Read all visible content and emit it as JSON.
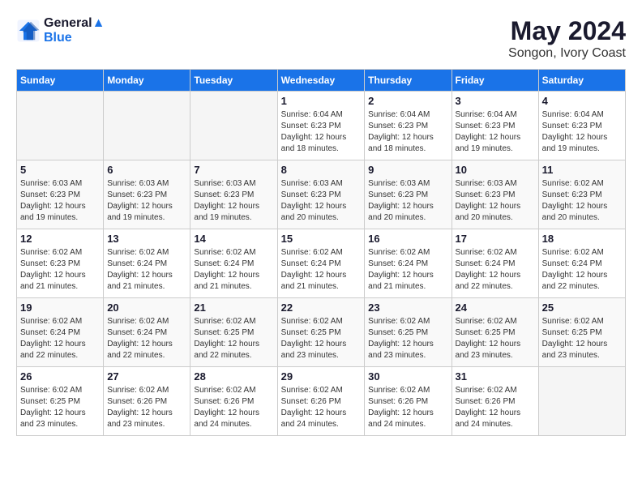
{
  "header": {
    "logo_line1": "General",
    "logo_line2": "Blue",
    "month": "May 2024",
    "location": "Songon, Ivory Coast"
  },
  "weekdays": [
    "Sunday",
    "Monday",
    "Tuesday",
    "Wednesday",
    "Thursday",
    "Friday",
    "Saturday"
  ],
  "weeks": [
    [
      {
        "day": "",
        "info": ""
      },
      {
        "day": "",
        "info": ""
      },
      {
        "day": "",
        "info": ""
      },
      {
        "day": "1",
        "info": "Sunrise: 6:04 AM\nSunset: 6:23 PM\nDaylight: 12 hours and 18 minutes."
      },
      {
        "day": "2",
        "info": "Sunrise: 6:04 AM\nSunset: 6:23 PM\nDaylight: 12 hours and 18 minutes."
      },
      {
        "day": "3",
        "info": "Sunrise: 6:04 AM\nSunset: 6:23 PM\nDaylight: 12 hours and 19 minutes."
      },
      {
        "day": "4",
        "info": "Sunrise: 6:04 AM\nSunset: 6:23 PM\nDaylight: 12 hours and 19 minutes."
      }
    ],
    [
      {
        "day": "5",
        "info": "Sunrise: 6:03 AM\nSunset: 6:23 PM\nDaylight: 12 hours and 19 minutes."
      },
      {
        "day": "6",
        "info": "Sunrise: 6:03 AM\nSunset: 6:23 PM\nDaylight: 12 hours and 19 minutes."
      },
      {
        "day": "7",
        "info": "Sunrise: 6:03 AM\nSunset: 6:23 PM\nDaylight: 12 hours and 19 minutes."
      },
      {
        "day": "8",
        "info": "Sunrise: 6:03 AM\nSunset: 6:23 PM\nDaylight: 12 hours and 20 minutes."
      },
      {
        "day": "9",
        "info": "Sunrise: 6:03 AM\nSunset: 6:23 PM\nDaylight: 12 hours and 20 minutes."
      },
      {
        "day": "10",
        "info": "Sunrise: 6:03 AM\nSunset: 6:23 PM\nDaylight: 12 hours and 20 minutes."
      },
      {
        "day": "11",
        "info": "Sunrise: 6:02 AM\nSunset: 6:23 PM\nDaylight: 12 hours and 20 minutes."
      }
    ],
    [
      {
        "day": "12",
        "info": "Sunrise: 6:02 AM\nSunset: 6:23 PM\nDaylight: 12 hours and 21 minutes."
      },
      {
        "day": "13",
        "info": "Sunrise: 6:02 AM\nSunset: 6:24 PM\nDaylight: 12 hours and 21 minutes."
      },
      {
        "day": "14",
        "info": "Sunrise: 6:02 AM\nSunset: 6:24 PM\nDaylight: 12 hours and 21 minutes."
      },
      {
        "day": "15",
        "info": "Sunrise: 6:02 AM\nSunset: 6:24 PM\nDaylight: 12 hours and 21 minutes."
      },
      {
        "day": "16",
        "info": "Sunrise: 6:02 AM\nSunset: 6:24 PM\nDaylight: 12 hours and 21 minutes."
      },
      {
        "day": "17",
        "info": "Sunrise: 6:02 AM\nSunset: 6:24 PM\nDaylight: 12 hours and 22 minutes."
      },
      {
        "day": "18",
        "info": "Sunrise: 6:02 AM\nSunset: 6:24 PM\nDaylight: 12 hours and 22 minutes."
      }
    ],
    [
      {
        "day": "19",
        "info": "Sunrise: 6:02 AM\nSunset: 6:24 PM\nDaylight: 12 hours and 22 minutes."
      },
      {
        "day": "20",
        "info": "Sunrise: 6:02 AM\nSunset: 6:24 PM\nDaylight: 12 hours and 22 minutes."
      },
      {
        "day": "21",
        "info": "Sunrise: 6:02 AM\nSunset: 6:25 PM\nDaylight: 12 hours and 22 minutes."
      },
      {
        "day": "22",
        "info": "Sunrise: 6:02 AM\nSunset: 6:25 PM\nDaylight: 12 hours and 23 minutes."
      },
      {
        "day": "23",
        "info": "Sunrise: 6:02 AM\nSunset: 6:25 PM\nDaylight: 12 hours and 23 minutes."
      },
      {
        "day": "24",
        "info": "Sunrise: 6:02 AM\nSunset: 6:25 PM\nDaylight: 12 hours and 23 minutes."
      },
      {
        "day": "25",
        "info": "Sunrise: 6:02 AM\nSunset: 6:25 PM\nDaylight: 12 hours and 23 minutes."
      }
    ],
    [
      {
        "day": "26",
        "info": "Sunrise: 6:02 AM\nSunset: 6:25 PM\nDaylight: 12 hours and 23 minutes."
      },
      {
        "day": "27",
        "info": "Sunrise: 6:02 AM\nSunset: 6:26 PM\nDaylight: 12 hours and 23 minutes."
      },
      {
        "day": "28",
        "info": "Sunrise: 6:02 AM\nSunset: 6:26 PM\nDaylight: 12 hours and 24 minutes."
      },
      {
        "day": "29",
        "info": "Sunrise: 6:02 AM\nSunset: 6:26 PM\nDaylight: 12 hours and 24 minutes."
      },
      {
        "day": "30",
        "info": "Sunrise: 6:02 AM\nSunset: 6:26 PM\nDaylight: 12 hours and 24 minutes."
      },
      {
        "day": "31",
        "info": "Sunrise: 6:02 AM\nSunset: 6:26 PM\nDaylight: 12 hours and 24 minutes."
      },
      {
        "day": "",
        "info": ""
      }
    ]
  ]
}
